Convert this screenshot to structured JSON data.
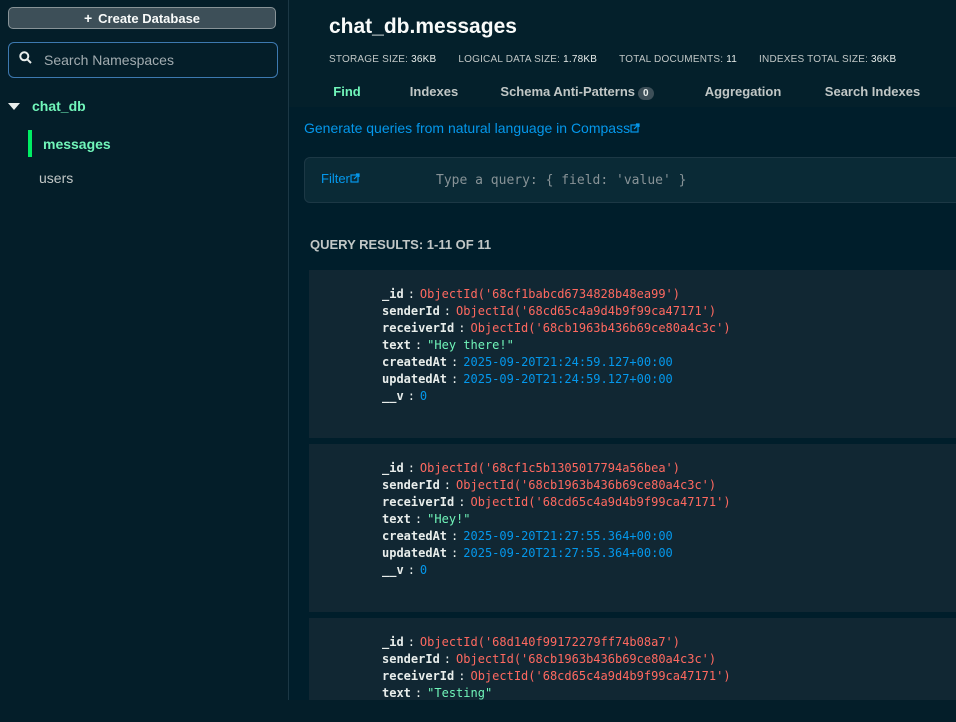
{
  "sidebar": {
    "create_db_label": "Create Database",
    "search_placeholder": "Search Namespaces",
    "database": "chat_db",
    "collections": [
      "messages",
      "users"
    ]
  },
  "main": {
    "title": "chat_db.messages",
    "stats": [
      {
        "label": "STORAGE SIZE:",
        "value": "36KB"
      },
      {
        "label": "LOGICAL DATA SIZE:",
        "value": "1.78KB"
      },
      {
        "label": "TOTAL DOCUMENTS:",
        "value": "11"
      },
      {
        "label": "INDEXES TOTAL SIZE:",
        "value": "36KB"
      }
    ],
    "tabs": [
      "Find",
      "Indexes",
      "Schema Anti-Patterns",
      "Aggregation",
      "Search Indexes"
    ],
    "schema_badge": "0",
    "nl_link": "Generate queries from natural language in Compass",
    "filter_label": "Filter",
    "filter_placeholder": "Type a query: { field: 'value' }",
    "results_label": "QUERY RESULTS: 1-11 OF 11"
  },
  "documents": [
    {
      "_id": "ObjectId('68cf1babcd6734828b48ea99')",
      "senderId": "ObjectId('68cd65c4a9d4b9f99ca47171')",
      "receiverId": "ObjectId('68cb1963b436b69ce80a4c3c')",
      "text": "\"Hey there!\"",
      "createdAt": "2025-09-20T21:24:59.127+00:00",
      "updatedAt": "2025-09-20T21:24:59.127+00:00",
      "__v": "0"
    },
    {
      "_id": "ObjectId('68cf1c5b1305017794a56bea')",
      "senderId": "ObjectId('68cb1963b436b69ce80a4c3c')",
      "receiverId": "ObjectId('68cd65c4a9d4b9f99ca47171')",
      "text": "\"Hey!\"",
      "createdAt": "2025-09-20T21:27:55.364+00:00",
      "updatedAt": "2025-09-20T21:27:55.364+00:00",
      "__v": "0"
    },
    {
      "_id": "ObjectId('68d140f99172279ff74b08a7')",
      "senderId": "ObjectId('68cb1963b436b69ce80a4c3c')",
      "receiverId": "ObjectId('68cd65c4a9d4b9f99ca47171')",
      "text": "\"Testing\""
    }
  ]
}
